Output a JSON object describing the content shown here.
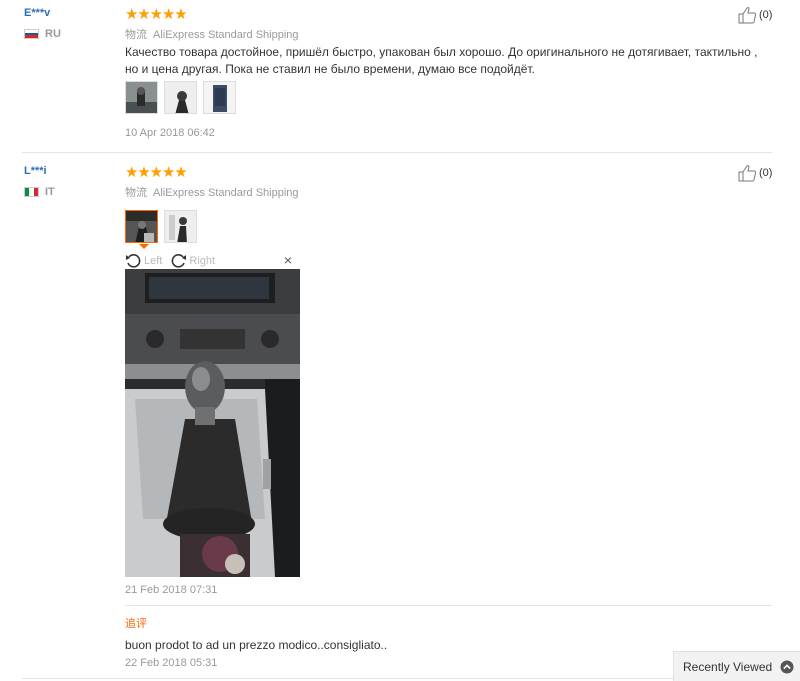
{
  "reviews": [
    {
      "user": "E***v",
      "country": "RU",
      "rating": 5,
      "logistics_cn": "物流",
      "shipping": "AliExpress Standard Shipping",
      "text": "Качество товара достойное, пришёл быстро, упакован был хорошо. До оригинального не дотягивает, тактильно , но и цена другая. Пока не ставил не было времени, думаю все подойдёт.",
      "photos": 3,
      "date": "10 Apr 2018 06:42",
      "helpful_count": "(0)"
    },
    {
      "user": "L***i",
      "country": "IT",
      "rating": 5,
      "logistics_cn": "物流",
      "shipping": "AliExpress Standard Shipping",
      "photos": 2,
      "viewer": {
        "rotate_left": "Left",
        "rotate_right": "Right",
        "close": "×"
      },
      "date": "21 Feb 2018 07:31",
      "helpful_count": "(0)",
      "additional_label": "追评",
      "additional_text": "buon prodot to ad un prezzo modico..consigliato..",
      "additional_date": "22 Feb 2018 05:31"
    }
  ],
  "recently_viewed": {
    "label": "Recently Viewed",
    "icon": "chevron-up-icon"
  },
  "colors": {
    "star": "#ff9e00",
    "user": "#2a6fb5",
    "accent": "#ff6600",
    "muted": "#999999"
  }
}
